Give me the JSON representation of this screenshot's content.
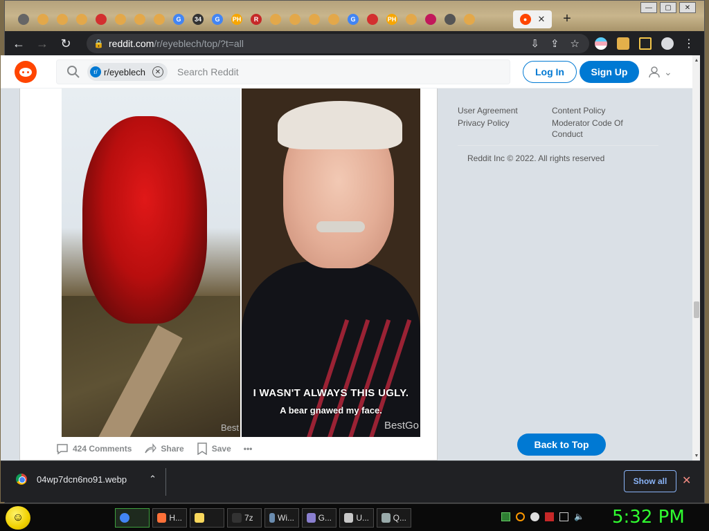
{
  "browser": {
    "url_host": "reddit.com",
    "url_path": "/r/eyeblech/top/?t=all",
    "tabs": [
      {
        "label": "",
        "icon": "page-icon",
        "color": "#666"
      },
      {
        "label": "",
        "icon": "reddit-icon",
        "color": "#e3a84a"
      },
      {
        "label": "",
        "icon": "reddit-icon",
        "color": "#e3a84a"
      },
      {
        "label": "",
        "icon": "reddit-icon",
        "color": "#e3a84a"
      },
      {
        "label": "",
        "icon": "home-icon",
        "color": "#d32f2f"
      },
      {
        "label": "",
        "icon": "reddit-icon",
        "color": "#e3a84a"
      },
      {
        "label": "",
        "icon": "reddit-icon",
        "color": "#e3a84a"
      },
      {
        "label": "",
        "icon": "reddit-icon",
        "color": "#e3a84a"
      },
      {
        "label": "G",
        "icon": "google-icon",
        "color": "#4285f4"
      },
      {
        "label": "34",
        "icon": "site-icon",
        "color": "#333"
      },
      {
        "label": "G",
        "icon": "google-icon",
        "color": "#4285f4"
      },
      {
        "label": "PH",
        "icon": "ph-icon",
        "color": "#f7a600"
      },
      {
        "label": "R",
        "icon": "r-icon",
        "color": "#c62828"
      },
      {
        "label": "",
        "icon": "reddit-icon",
        "color": "#e3a84a"
      },
      {
        "label": "",
        "icon": "reddit-icon",
        "color": "#e3a84a"
      },
      {
        "label": "",
        "icon": "reddit-icon",
        "color": "#e3a84a"
      },
      {
        "label": "",
        "icon": "download-icon",
        "color": "#e3a84a"
      },
      {
        "label": "G",
        "icon": "google-icon",
        "color": "#4285f4"
      },
      {
        "label": "",
        "icon": "home-icon",
        "color": "#d32f2f"
      },
      {
        "label": "PH",
        "icon": "ph-icon",
        "color": "#f7a600"
      },
      {
        "label": "",
        "icon": "reddit-icon",
        "color": "#e3a84a"
      },
      {
        "label": "",
        "icon": "link-icon",
        "color": "#c2185b"
      },
      {
        "label": "",
        "icon": "chrome-icon",
        "color": "#555"
      },
      {
        "label": "",
        "icon": "reddit-icon",
        "color": "#e3a84a"
      }
    ],
    "active_tab_close": "✕",
    "new_tab": "+"
  },
  "reddit": {
    "subreddit_chip": "r/eyeblech",
    "subreddit_chip_icon": "r/",
    "search_placeholder": "Search Reddit",
    "login": "Log In",
    "signup": "Sign Up",
    "brand_color": "#ff4500",
    "accent_color": "#0079d3"
  },
  "post": {
    "caption_line1": "I WASN'T ALWAYS THIS UGLY.",
    "caption_line2": "A bear gnawed my face.",
    "watermark_left": "Best",
    "watermark_right": "BestGo",
    "comments": "424 Comments",
    "share": "Share",
    "save": "Save",
    "more": "•••"
  },
  "sidebar": {
    "links": [
      "User Agreement",
      "Content Policy",
      "Privacy Policy",
      "Moderator Code Of Conduct"
    ],
    "copyright": "Reddit Inc © 2022. All rights reserved",
    "back_to_top": "Back to Top"
  },
  "downloads": {
    "filename": "04wp7dcn6no91.webp",
    "show_all": "Show all"
  },
  "taskbar": {
    "items": [
      {
        "label": "",
        "icon": "chrome-icon"
      },
      {
        "label": "H...",
        "icon": "firefox-icon"
      },
      {
        "label": "",
        "icon": "folder-icon"
      },
      {
        "label": "7z",
        "icon": "7zip-icon"
      },
      {
        "label": "Wi...",
        "icon": "window-icon"
      },
      {
        "label": "G...",
        "icon": "app-icon"
      },
      {
        "label": "U...",
        "icon": "app-icon"
      },
      {
        "label": "Q...",
        "icon": "app-icon"
      }
    ],
    "clock": "5:32 PM"
  }
}
